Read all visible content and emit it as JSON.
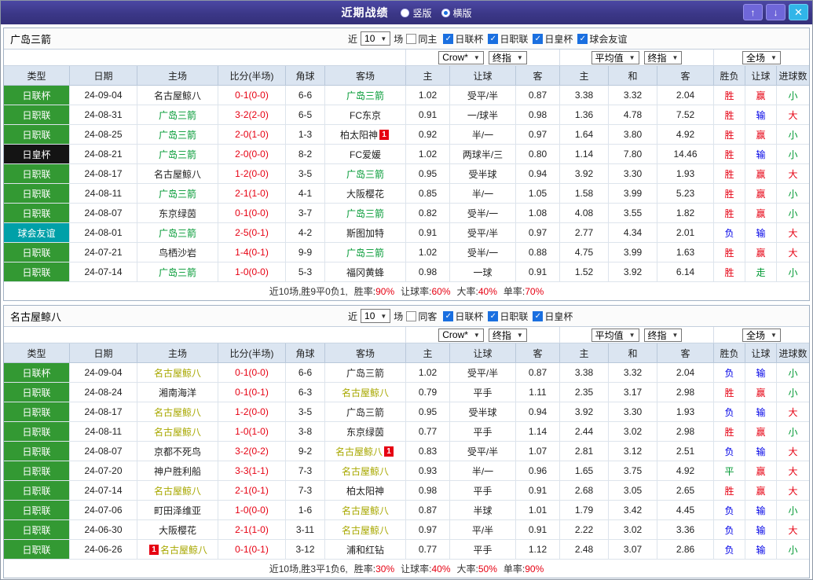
{
  "titlebar": {
    "title": "近期战绩",
    "radios": [
      {
        "label": "竖版",
        "checked": false
      },
      {
        "label": "横版",
        "checked": true
      }
    ],
    "buttons": {
      "up": "↑",
      "down": "↓",
      "close": "✕"
    }
  },
  "columns": [
    "类型",
    "日期",
    "主场",
    "比分(半场)",
    "角球",
    "客场",
    "主",
    "让球",
    "客",
    "主",
    "和",
    "客",
    "胜负",
    "让球",
    "进球数"
  ],
  "colors": {
    "titlebar_purple": "#3b3787",
    "league_green": "#339933",
    "league_black": "#141414",
    "league_teal": "#00a0a8",
    "win_red": "#e60012",
    "lose_blue": "#0000e6",
    "draw_green": "#009933",
    "focal_team_green": "#009933",
    "focal_team_olive": "#a8a800",
    "header_blue": "#dbe5f1"
  },
  "sections": [
    {
      "team": "广岛三箭",
      "focal": "green",
      "filters": {
        "near_label": "近",
        "count": "10",
        "unit_label": "场",
        "same_label": "同主",
        "same_checked": false,
        "leagues": [
          {
            "label": "日联杯",
            "checked": true
          },
          {
            "label": "日职联",
            "checked": true
          },
          {
            "label": "日皇杯",
            "checked": true
          },
          {
            "label": "球会友谊",
            "checked": true
          }
        ]
      },
      "dropdowns": {
        "crown_source": "Crow*",
        "crown_time": "终指",
        "euro_source": "平均值",
        "euro_time": "终指",
        "scope": "全场"
      },
      "rows": [
        {
          "league": "日联杯",
          "league_color": "green",
          "date": "24-09-04",
          "home": "名古屋鲸八",
          "home_focal": false,
          "score": "0-1(0-0)",
          "corners": "6-6",
          "away": "广岛三箭",
          "away_focal": true,
          "crown_home": "1.02",
          "handicap": "受平/半",
          "crown_away": "0.87",
          "euro_home": "3.38",
          "euro_draw": "3.32",
          "euro_away": "2.04",
          "result": "胜",
          "result_color": "red",
          "handicap_result": "赢",
          "handicap_result_color": "red",
          "goals": "小",
          "goals_color": "green"
        },
        {
          "league": "日职联",
          "league_color": "green",
          "date": "24-08-31",
          "home": "广岛三箭",
          "home_focal": true,
          "score": "3-2(2-0)",
          "corners": "6-5",
          "away": "FC东京",
          "away_focal": false,
          "crown_home": "0.91",
          "handicap": "一/球半",
          "crown_away": "0.98",
          "euro_home": "1.36",
          "euro_draw": "4.78",
          "euro_away": "7.52",
          "result": "胜",
          "result_color": "red",
          "handicap_result": "输",
          "handicap_result_color": "blue",
          "goals": "大",
          "goals_color": "red"
        },
        {
          "league": "日职联",
          "league_color": "green",
          "date": "24-08-25",
          "home": "广岛三箭",
          "home_focal": true,
          "score": "2-0(1-0)",
          "corners": "1-3",
          "away": "柏太阳神",
          "away_focal": false,
          "away_badge": "1",
          "away_badge_pos": "after",
          "crown_home": "0.92",
          "handicap": "半/一",
          "crown_away": "0.97",
          "euro_home": "1.64",
          "euro_draw": "3.80",
          "euro_away": "4.92",
          "result": "胜",
          "result_color": "red",
          "handicap_result": "赢",
          "handicap_result_color": "red",
          "goals": "小",
          "goals_color": "green"
        },
        {
          "league": "日皇杯",
          "league_color": "black",
          "date": "24-08-21",
          "home": "广岛三箭",
          "home_focal": true,
          "score": "2-0(0-0)",
          "corners": "8-2",
          "away": "FC爱媛",
          "away_focal": false,
          "crown_home": "1.02",
          "handicap": "两球半/三",
          "crown_away": "0.80",
          "euro_home": "1.14",
          "euro_draw": "7.80",
          "euro_away": "14.46",
          "result": "胜",
          "result_color": "red",
          "handicap_result": "输",
          "handicap_result_color": "blue",
          "goals": "小",
          "goals_color": "green"
        },
        {
          "league": "日职联",
          "league_color": "green",
          "date": "24-08-17",
          "home": "名古屋鲸八",
          "home_focal": false,
          "score": "1-2(0-0)",
          "corners": "3-5",
          "away": "广岛三箭",
          "away_focal": true,
          "crown_home": "0.95",
          "handicap": "受半球",
          "crown_away": "0.94",
          "euro_home": "3.92",
          "euro_draw": "3.30",
          "euro_away": "1.93",
          "result": "胜",
          "result_color": "red",
          "handicap_result": "赢",
          "handicap_result_color": "red",
          "goals": "大",
          "goals_color": "red"
        },
        {
          "league": "日职联",
          "league_color": "green",
          "date": "24-08-11",
          "home": "广岛三箭",
          "home_focal": true,
          "score": "2-1(1-0)",
          "corners": "4-1",
          "away": "大阪樱花",
          "away_focal": false,
          "crown_home": "0.85",
          "handicap": "半/一",
          "crown_away": "1.05",
          "euro_home": "1.58",
          "euro_draw": "3.99",
          "euro_away": "5.23",
          "result": "胜",
          "result_color": "red",
          "handicap_result": "赢",
          "handicap_result_color": "red",
          "goals": "小",
          "goals_color": "green"
        },
        {
          "league": "日职联",
          "league_color": "green",
          "date": "24-08-07",
          "home": "东京绿茵",
          "home_focal": false,
          "score": "0-1(0-0)",
          "corners": "3-7",
          "away": "广岛三箭",
          "away_focal": true,
          "crown_home": "0.82",
          "handicap": "受半/一",
          "crown_away": "1.08",
          "euro_home": "4.08",
          "euro_draw": "3.55",
          "euro_away": "1.82",
          "result": "胜",
          "result_color": "red",
          "handicap_result": "赢",
          "handicap_result_color": "red",
          "goals": "小",
          "goals_color": "green"
        },
        {
          "league": "球会友谊",
          "league_color": "teal",
          "date": "24-08-01",
          "home": "广岛三箭",
          "home_focal": true,
          "score": "2-5(0-1)",
          "corners": "4-2",
          "away": "斯图加特",
          "away_focal": false,
          "crown_home": "0.91",
          "handicap": "受平/半",
          "crown_away": "0.97",
          "euro_home": "2.77",
          "euro_draw": "4.34",
          "euro_away": "2.01",
          "result": "负",
          "result_color": "blue",
          "handicap_result": "输",
          "handicap_result_color": "blue",
          "goals": "大",
          "goals_color": "red"
        },
        {
          "league": "日职联",
          "league_color": "green",
          "date": "24-07-21",
          "home": "鸟栖沙岩",
          "home_focal": false,
          "score": "1-4(0-1)",
          "corners": "9-9",
          "away": "广岛三箭",
          "away_focal": true,
          "crown_home": "1.02",
          "handicap": "受半/一",
          "crown_away": "0.88",
          "euro_home": "4.75",
          "euro_draw": "3.99",
          "euro_away": "1.63",
          "result": "胜",
          "result_color": "red",
          "handicap_result": "赢",
          "handicap_result_color": "red",
          "goals": "大",
          "goals_color": "red"
        },
        {
          "league": "日职联",
          "league_color": "green",
          "date": "24-07-14",
          "home": "广岛三箭",
          "home_focal": true,
          "score": "1-0(0-0)",
          "corners": "5-3",
          "away": "福冈黄蜂",
          "away_focal": false,
          "crown_home": "0.98",
          "handicap": "一球",
          "crown_away": "0.91",
          "euro_home": "1.52",
          "euro_draw": "3.92",
          "euro_away": "6.14",
          "result": "胜",
          "result_color": "red",
          "handicap_result": "走",
          "handicap_result_color": "green",
          "goals": "小",
          "goals_color": "green"
        }
      ],
      "summary": {
        "prefix": "近10场,胜9平0负1,",
        "stats": [
          {
            "label": "胜率:",
            "value": "90%"
          },
          {
            "label": "让球率:",
            "value": "60%"
          },
          {
            "label": "大率:",
            "value": "40%"
          },
          {
            "label": "单率:",
            "value": "70%"
          }
        ]
      }
    },
    {
      "team": "名古屋鲸八",
      "focal": "olive",
      "filters": {
        "near_label": "近",
        "count": "10",
        "unit_label": "场",
        "same_label": "同客",
        "same_checked": false,
        "leagues": [
          {
            "label": "日联杯",
            "checked": true
          },
          {
            "label": "日职联",
            "checked": true
          },
          {
            "label": "日皇杯",
            "checked": true
          }
        ]
      },
      "dropdowns": {
        "crown_source": "Crow*",
        "crown_time": "终指",
        "euro_source": "平均值",
        "euro_time": "终指",
        "scope": "全场"
      },
      "rows": [
        {
          "league": "日联杯",
          "league_color": "green",
          "date": "24-09-04",
          "home": "名古屋鲸八",
          "home_focal": true,
          "score": "0-1(0-0)",
          "corners": "6-6",
          "away": "广岛三箭",
          "away_focal": false,
          "crown_home": "1.02",
          "handicap": "受平/半",
          "crown_away": "0.87",
          "euro_home": "3.38",
          "euro_draw": "3.32",
          "euro_away": "2.04",
          "result": "负",
          "result_color": "blue",
          "handicap_result": "输",
          "handicap_result_color": "blue",
          "goals": "小",
          "goals_color": "green"
        },
        {
          "league": "日职联",
          "league_color": "green",
          "date": "24-08-24",
          "home": "湘南海洋",
          "home_focal": false,
          "score": "0-1(0-1)",
          "corners": "6-3",
          "away": "名古屋鲸八",
          "away_focal": true,
          "crown_home": "0.79",
          "handicap": "平手",
          "crown_away": "1.11",
          "euro_home": "2.35",
          "euro_draw": "3.17",
          "euro_away": "2.98",
          "result": "胜",
          "result_color": "red",
          "handicap_result": "赢",
          "handicap_result_color": "red",
          "goals": "小",
          "goals_color": "green"
        },
        {
          "league": "日职联",
          "league_color": "green",
          "date": "24-08-17",
          "home": "名古屋鲸八",
          "home_focal": true,
          "score": "1-2(0-0)",
          "corners": "3-5",
          "away": "广岛三箭",
          "away_focal": false,
          "crown_home": "0.95",
          "handicap": "受半球",
          "crown_away": "0.94",
          "euro_home": "3.92",
          "euro_draw": "3.30",
          "euro_away": "1.93",
          "result": "负",
          "result_color": "blue",
          "handicap_result": "输",
          "handicap_result_color": "blue",
          "goals": "大",
          "goals_color": "red"
        },
        {
          "league": "日职联",
          "league_color": "green",
          "date": "24-08-11",
          "home": "名古屋鲸八",
          "home_focal": true,
          "score": "1-0(1-0)",
          "corners": "3-8",
          "away": "东京绿茵",
          "away_focal": false,
          "crown_home": "0.77",
          "handicap": "平手",
          "crown_away": "1.14",
          "euro_home": "2.44",
          "euro_draw": "3.02",
          "euro_away": "2.98",
          "result": "胜",
          "result_color": "red",
          "handicap_result": "赢",
          "handicap_result_color": "red",
          "goals": "小",
          "goals_color": "green"
        },
        {
          "league": "日职联",
          "league_color": "green",
          "date": "24-08-07",
          "home": "京都不死鸟",
          "home_focal": false,
          "score": "3-2(0-2)",
          "corners": "9-2",
          "away": "名古屋鲸八",
          "away_focal": true,
          "away_badge": "1",
          "away_badge_pos": "after",
          "crown_home": "0.83",
          "handicap": "受平/半",
          "crown_away": "1.07",
          "euro_home": "2.81",
          "euro_draw": "3.12",
          "euro_away": "2.51",
          "result": "负",
          "result_color": "blue",
          "handicap_result": "输",
          "handicap_result_color": "blue",
          "goals": "大",
          "goals_color": "red"
        },
        {
          "league": "日职联",
          "league_color": "green",
          "date": "24-07-20",
          "home": "神户胜利船",
          "home_focal": false,
          "score": "3-3(1-1)",
          "corners": "7-3",
          "away": "名古屋鲸八",
          "away_focal": true,
          "crown_home": "0.93",
          "handicap": "半/一",
          "crown_away": "0.96",
          "euro_home": "1.65",
          "euro_draw": "3.75",
          "euro_away": "4.92",
          "result": "平",
          "result_color": "green",
          "handicap_result": "赢",
          "handicap_result_color": "red",
          "goals": "大",
          "goals_color": "red"
        },
        {
          "league": "日职联",
          "league_color": "green",
          "date": "24-07-14",
          "home": "名古屋鲸八",
          "home_focal": true,
          "score": "2-1(0-1)",
          "corners": "7-3",
          "away": "柏太阳神",
          "away_focal": false,
          "crown_home": "0.98",
          "handicap": "平手",
          "crown_away": "0.91",
          "euro_home": "2.68",
          "euro_draw": "3.05",
          "euro_away": "2.65",
          "result": "胜",
          "result_color": "red",
          "handicap_result": "赢",
          "handicap_result_color": "red",
          "goals": "大",
          "goals_color": "red"
        },
        {
          "league": "日职联",
          "league_color": "green",
          "date": "24-07-06",
          "home": "町田泽维亚",
          "home_focal": false,
          "score": "1-0(0-0)",
          "corners": "1-6",
          "away": "名古屋鲸八",
          "away_focal": true,
          "crown_home": "0.87",
          "handicap": "半球",
          "crown_away": "1.01",
          "euro_home": "1.79",
          "euro_draw": "3.42",
          "euro_away": "4.45",
          "result": "负",
          "result_color": "blue",
          "handicap_result": "输",
          "handicap_result_color": "blue",
          "goals": "小",
          "goals_color": "green"
        },
        {
          "league": "日职联",
          "league_color": "green",
          "date": "24-06-30",
          "home": "大阪樱花",
          "home_focal": false,
          "score": "2-1(1-0)",
          "corners": "3-11",
          "away": "名古屋鲸八",
          "away_focal": true,
          "crown_home": "0.97",
          "handicap": "平/半",
          "crown_away": "0.91",
          "euro_home": "2.22",
          "euro_draw": "3.02",
          "euro_away": "3.36",
          "result": "负",
          "result_color": "blue",
          "handicap_result": "输",
          "handicap_result_color": "blue",
          "goals": "大",
          "goals_color": "red"
        },
        {
          "league": "日职联",
          "league_color": "green",
          "date": "24-06-26",
          "home": "名古屋鲸八",
          "home_focal": true,
          "home_badge": "1",
          "home_badge_pos": "before",
          "score": "0-1(0-1)",
          "corners": "3-12",
          "away": "浦和红钻",
          "away_focal": false,
          "crown_home": "0.77",
          "handicap": "平手",
          "crown_away": "1.12",
          "euro_home": "2.48",
          "euro_draw": "3.07",
          "euro_away": "2.86",
          "result": "负",
          "result_color": "blue",
          "handicap_result": "输",
          "handicap_result_color": "blue",
          "goals": "小",
          "goals_color": "green"
        }
      ],
      "summary": {
        "prefix": "近10场,胜3平1负6,",
        "stats": [
          {
            "label": "胜率:",
            "value": "30%"
          },
          {
            "label": "让球率:",
            "value": "40%"
          },
          {
            "label": "大率:",
            "value": "50%"
          },
          {
            "label": "单率:",
            "value": "90%"
          }
        ]
      }
    }
  ]
}
